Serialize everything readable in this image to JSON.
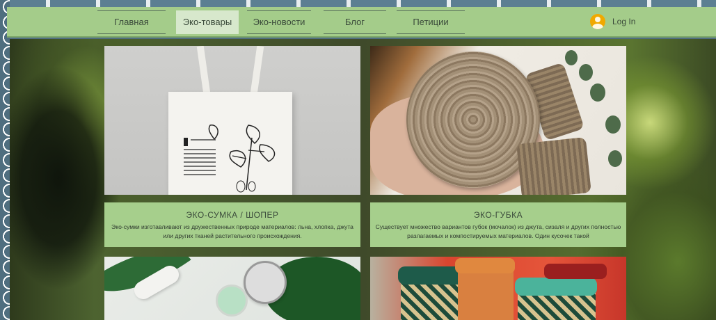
{
  "nav": {
    "items": [
      {
        "label": "Главная"
      },
      {
        "label": "Эко-товары"
      },
      {
        "label": "Эко-новости"
      },
      {
        "label": "Блог"
      },
      {
        "label": "Петиции"
      }
    ],
    "login_label": "Log In"
  },
  "cards": [
    {
      "title": "ЭКО-СУМКА / ШОПЕР",
      "text": "Эко-сумки изготавливают из дружественных природе материалов: льна, хлопка, джута или других тканей растительного происхождения."
    },
    {
      "title": "ЭКО-ГУБКА",
      "text": "Существует множество вариантов губок (мочалок) из джута, сизаля и других полностью разлагаемых и компостируемых материалов. Один кусочек такой"
    }
  ],
  "colors": {
    "nav_bg": "#a4cc8a",
    "card_bg": "#a6cf8c",
    "accent_avatar": "#f0a900"
  }
}
